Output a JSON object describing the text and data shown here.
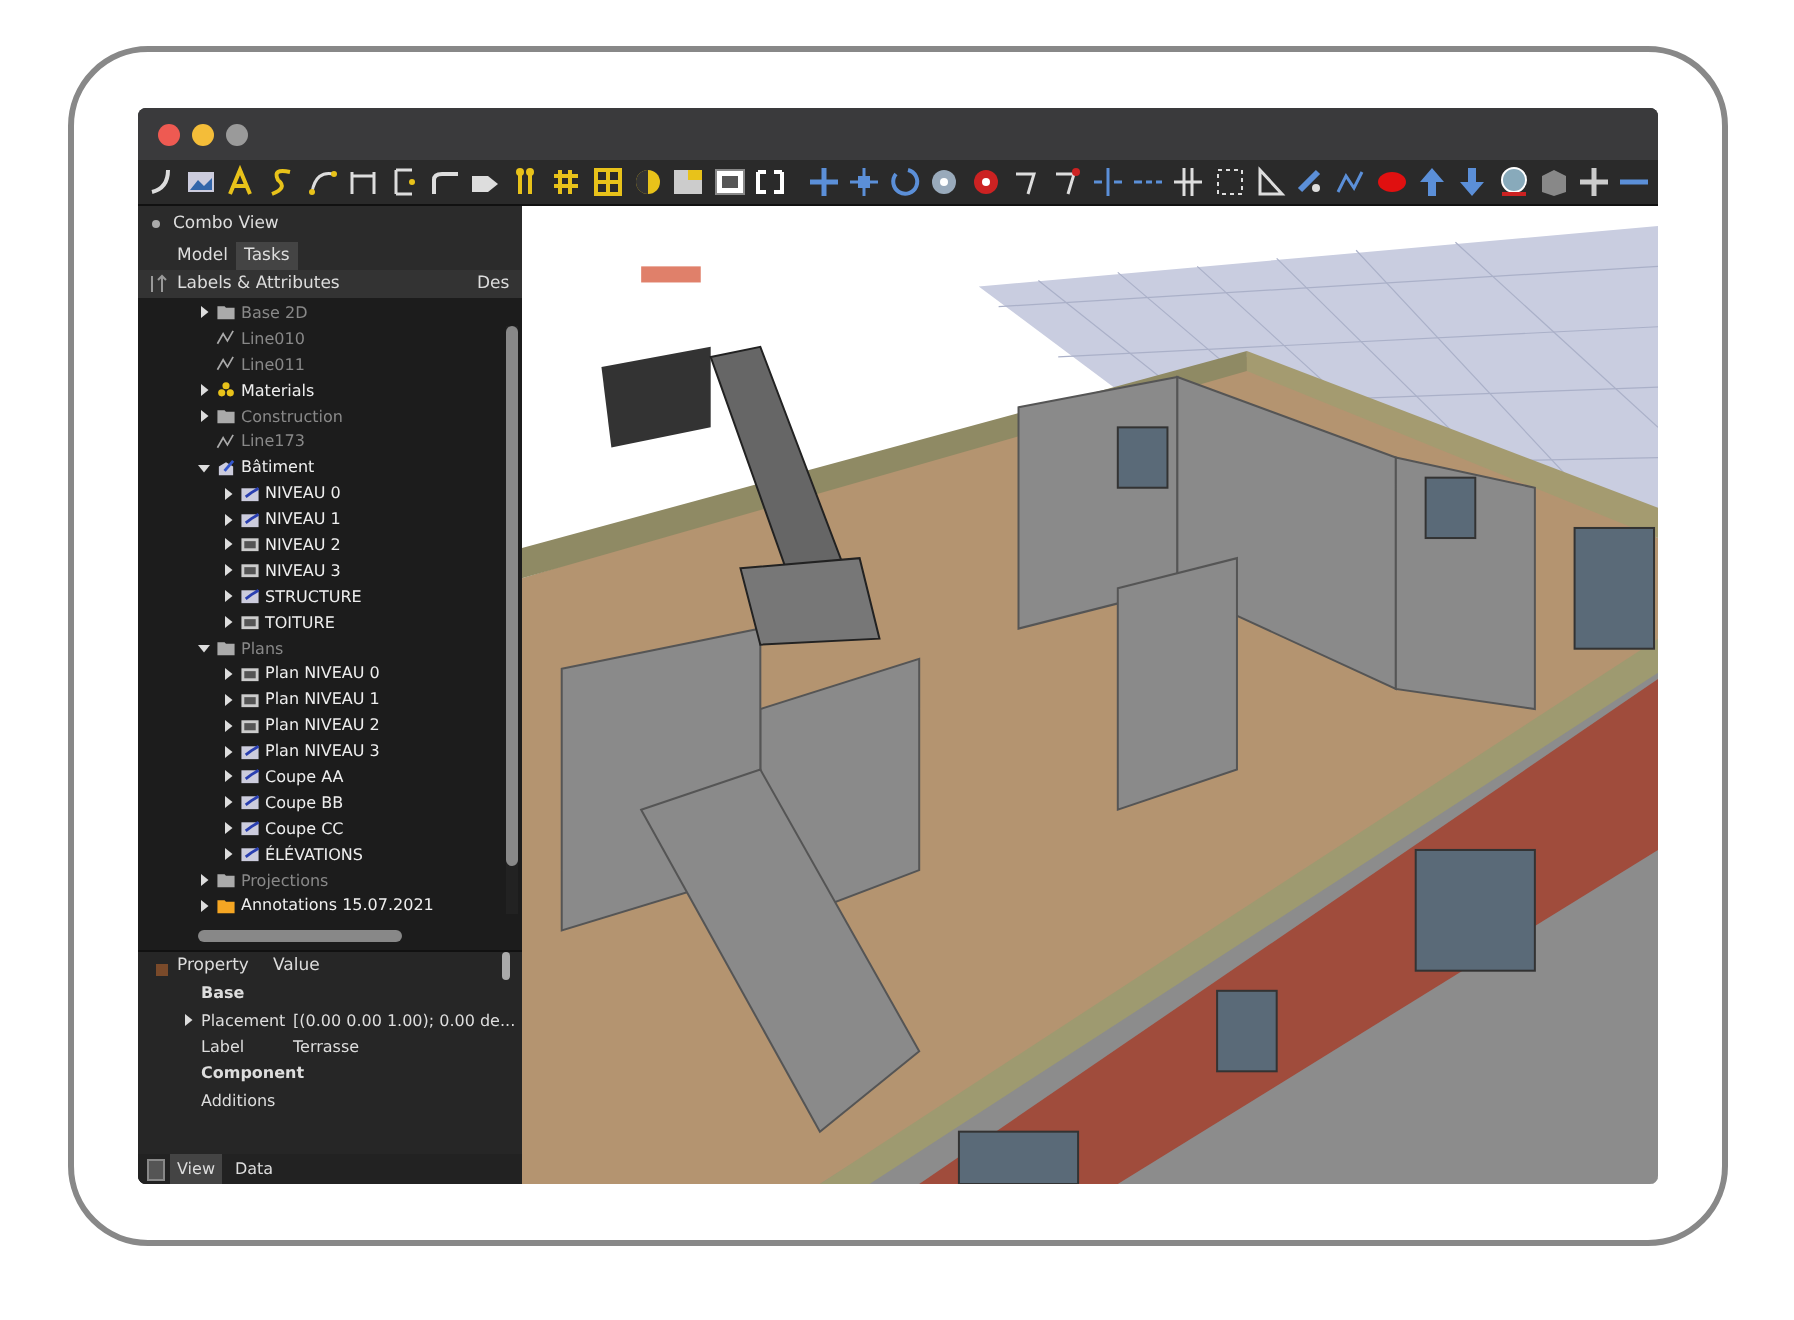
{
  "panel": {
    "title": "Combo View",
    "tabs": [
      {
        "label": "Model",
        "selected": false
      },
      {
        "label": "Tasks",
        "selected": true
      }
    ],
    "tree": {
      "columns": [
        "Labels & Attributes",
        "Des"
      ],
      "items": [
        {
          "label": "Base 2D",
          "kind": "folder",
          "hidden": true,
          "expanded": false
        },
        {
          "label": "Line010",
          "kind": "line",
          "hidden": true
        },
        {
          "label": "Line011",
          "kind": "line",
          "hidden": true
        },
        {
          "label": "Materials",
          "kind": "materials",
          "hidden": false,
          "expanded": false
        },
        {
          "label": "Construction",
          "kind": "folder",
          "hidden": true,
          "expanded": false
        },
        {
          "label": "Line173",
          "kind": "line",
          "hidden": true
        },
        {
          "label": "Bâtiment",
          "kind": "building",
          "hidden": false,
          "expanded": true,
          "children": [
            {
              "label": "NIVEAU 0",
              "kind": "level",
              "hidden": false,
              "expanded": false
            },
            {
              "label": "NIVEAU 1",
              "kind": "level",
              "hidden": false,
              "expanded": false
            },
            {
              "label": "NIVEAU 2",
              "kind": "sheet",
              "hidden": false,
              "expanded": false
            },
            {
              "label": "NIVEAU 3",
              "kind": "sheet",
              "hidden": false,
              "expanded": false
            },
            {
              "label": "STRUCTURE",
              "kind": "level",
              "hidden": false,
              "expanded": false
            },
            {
              "label": "TOITURE",
              "kind": "sheet",
              "hidden": false,
              "expanded": false
            }
          ]
        },
        {
          "label": "Plans",
          "kind": "folder",
          "hidden": true,
          "expanded": true,
          "children": [
            {
              "label": "Plan NIVEAU 0",
              "kind": "sheet",
              "hidden": false,
              "expanded": false
            },
            {
              "label": "Plan NIVEAU 1",
              "kind": "sheet",
              "hidden": false,
              "expanded": false
            },
            {
              "label": "Plan NIVEAU 2",
              "kind": "sheet",
              "hidden": false,
              "expanded": false
            },
            {
              "label": "Plan NIVEAU 3",
              "kind": "level",
              "hidden": false,
              "expanded": false
            },
            {
              "label": "Coupe AA",
              "kind": "level",
              "hidden": false,
              "expanded": false
            },
            {
              "label": "Coupe BB",
              "kind": "level",
              "hidden": false,
              "expanded": false
            },
            {
              "label": "Coupe CC",
              "kind": "level",
              "hidden": false,
              "expanded": false
            },
            {
              "label": "ÉLÉVATIONS",
              "kind": "level",
              "hidden": false,
              "expanded": false
            }
          ]
        },
        {
          "label": "Projections",
          "kind": "folder",
          "hidden": true,
          "expanded": false
        },
        {
          "label": "Annotations 15.07.2021",
          "kind": "annotation",
          "hidden": false,
          "expanded": false
        }
      ]
    },
    "properties": {
      "columns": [
        "Property",
        "Value"
      ],
      "rows": [
        {
          "kind": "group",
          "name": "Base"
        },
        {
          "kind": "property",
          "name": "Placement",
          "value": "[(0.00 0.00 1.00); 0.00 de...",
          "expanded": false
        },
        {
          "kind": "property",
          "name": "Label",
          "value": "Terrasse"
        },
        {
          "kind": "group",
          "name": "Component"
        },
        {
          "kind": "property",
          "name": "Additions",
          "value": ""
        }
      ]
    },
    "bottom_tabs": [
      {
        "label": "View",
        "selected": true
      },
      {
        "label": "Data",
        "selected": false
      }
    ]
  }
}
